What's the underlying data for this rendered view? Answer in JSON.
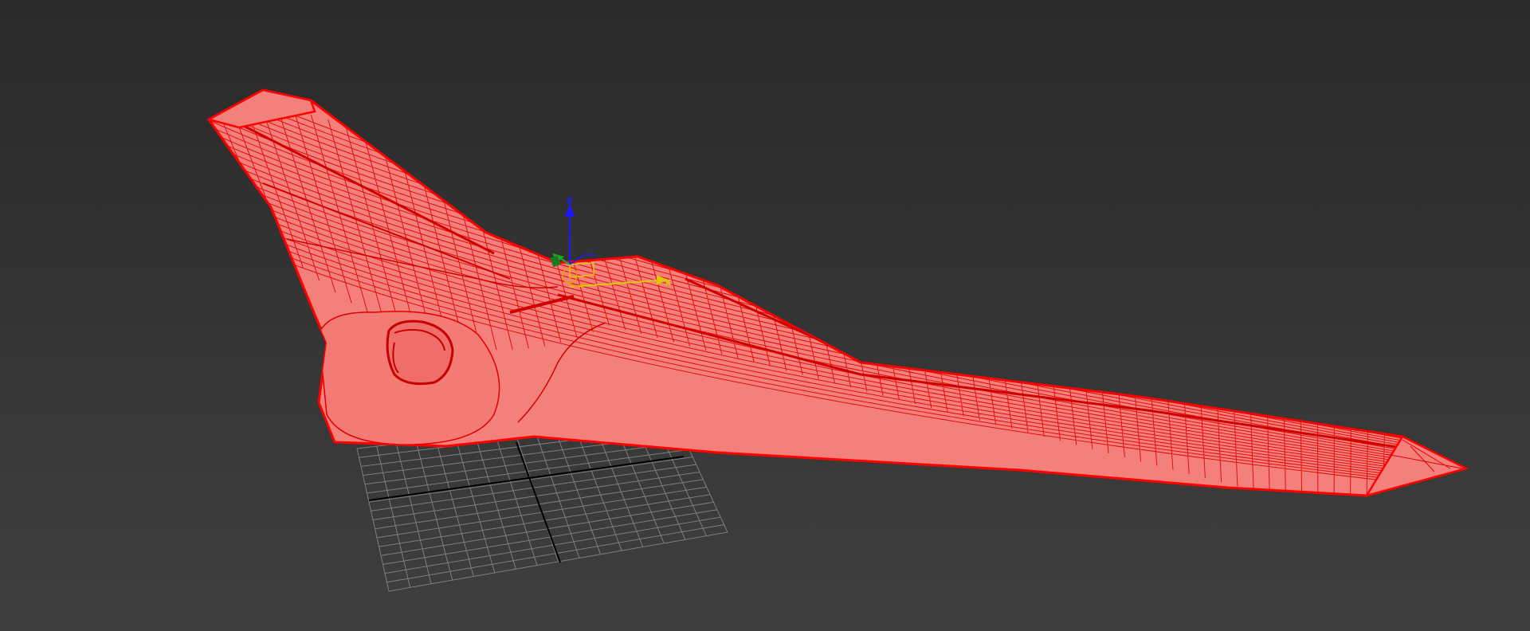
{
  "viewport": {
    "background_color": "#333333",
    "grid_color": "#8a8a8a",
    "grid_axis_color": "#000000",
    "selection_color": "#ff0000",
    "selection_fill": "#f4807c"
  },
  "model": {
    "object": "flying-wing-mesh",
    "display_mode": "wireframe-on-shaded",
    "selected": true
  },
  "gizmo": {
    "type": "move-transform",
    "axes": [
      {
        "name": "z",
        "label": "z",
        "color": "#1a1aff"
      },
      {
        "name": "x",
        "label": "x",
        "color": "#e0c800"
      },
      {
        "name": "y",
        "label": "y",
        "color": "#22aa22"
      }
    ]
  }
}
